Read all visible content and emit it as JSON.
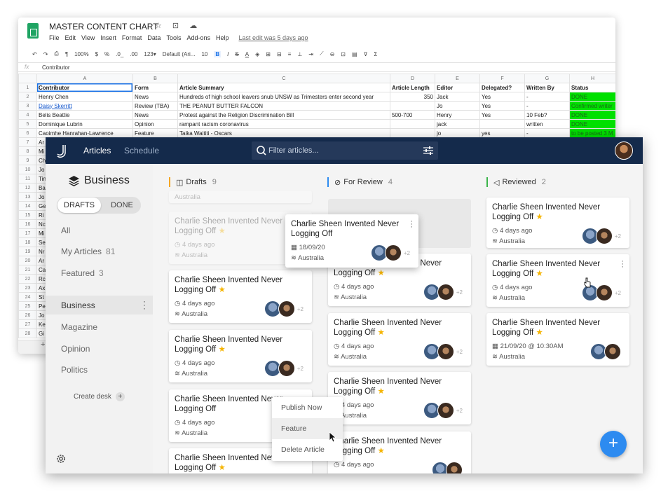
{
  "sheet": {
    "title": "MASTER CONTENT CHART",
    "title_icons": "☆ ⊡ ☁",
    "menu": [
      "File",
      "Edit",
      "View",
      "Insert",
      "Format",
      "Data",
      "Tools",
      "Add-ons",
      "Help"
    ],
    "last_edit": "Last edit was 5 days ago",
    "toolbar": {
      "zoom": "100%",
      "currency": "$",
      "percent": "%",
      "decimal_less": ".0_",
      "decimal_more": ".00",
      "format_more": "123▾",
      "font": "Default (Ari...",
      "font_size": "10",
      "bold": "B",
      "italic": "I",
      "strike": "S",
      "text_color": "A",
      "sum": "Σ"
    },
    "fx_label": "fx",
    "formula_value": "Contributor",
    "columns": [
      "A",
      "B",
      "C",
      "D",
      "E",
      "F",
      "G",
      "H"
    ],
    "headers": [
      "Contributor",
      "Form",
      "Article Summary",
      "Article Length",
      "Editor",
      "Delegated?",
      "Written By",
      "Status"
    ],
    "rows": [
      [
        "Henry Chen",
        "News",
        "Hundreds of high school leavers snub UNSW as Trimesters enter second year",
        "350",
        "Jack",
        "Yes",
        "-",
        "DONE"
      ],
      [
        "Daisy Skerritt",
        "Review (TBA)",
        "THE PEANUT BUTTER FALCON",
        "",
        "Jo",
        "Yes",
        "-",
        "Confirmed writer"
      ],
      [
        "Belis Beattie",
        "News",
        "Protest against the Religion Discrimination Bill",
        "500-700",
        "Henry",
        "Yes",
        "10 Feb?",
        "DONE"
      ],
      [
        "Dominique Lubrin",
        "Opinion",
        "rampant racism coronavirus",
        "",
        "jack",
        "",
        "written",
        "DONE"
      ],
      [
        "Caoimhe Hanrahan-Lawrence",
        "Feature",
        "Taika Waititi - Oscars",
        "",
        "jo",
        "yes",
        "-",
        "to be posted 3 M"
      ]
    ],
    "extra_rows": [
      "Ar",
      "Mi",
      "Ch",
      "Jo",
      "Tin",
      "Ba",
      "Jo",
      "Ge",
      "Ri",
      "Nc",
      "Mi",
      "Se",
      "Nr",
      "Ar",
      "Ca",
      "Rc",
      "Ax",
      "St",
      "Pe",
      "Jo",
      "Ke",
      "Gi"
    ],
    "bottom_plus": "+"
  },
  "app": {
    "nav": {
      "articles": "Articles",
      "schedule": "Schedule"
    },
    "search_placeholder": "Filter articles...",
    "desk": {
      "title": "Business",
      "toggle_drafts": "DRAFTS",
      "toggle_done": "DONE",
      "all": "All",
      "my_articles": "My Articles",
      "my_articles_count": "81",
      "featured": "Featured",
      "featured_count": "3",
      "desks": [
        "Business",
        "Magazine",
        "Opinion",
        "Politics"
      ],
      "create_desk": "Create desk"
    },
    "columns": [
      {
        "title": "Drafts",
        "count": "9",
        "color": "#f5a623"
      },
      {
        "title": "For Review",
        "count": "4",
        "color": "#2d8bf0"
      },
      {
        "title": "Reviewed",
        "count": "2",
        "color": "#3bb54a"
      }
    ],
    "card_title": "Charlie Sheen Invented Never Logging Off",
    "card_date": "4 days ago",
    "card_location": "Australia",
    "card_more": "+2",
    "partial_title": "Charlie Sheen Invented Neve",
    "partial_title_tail": "rlie Sheen Invented Never",
    "drag_card_date": "18/09/20",
    "scheduled_date": "21/09/20 @ 10:30AM",
    "top_partial_loc": "Australia",
    "context_menu": [
      "Publish Now",
      "Feature",
      "Delete Article"
    ],
    "fab": "+",
    "colors": {
      "topbar": "#142a4b",
      "accent": "#2d8bf0",
      "star": "#f5b400",
      "status_green": "#00e000"
    }
  }
}
